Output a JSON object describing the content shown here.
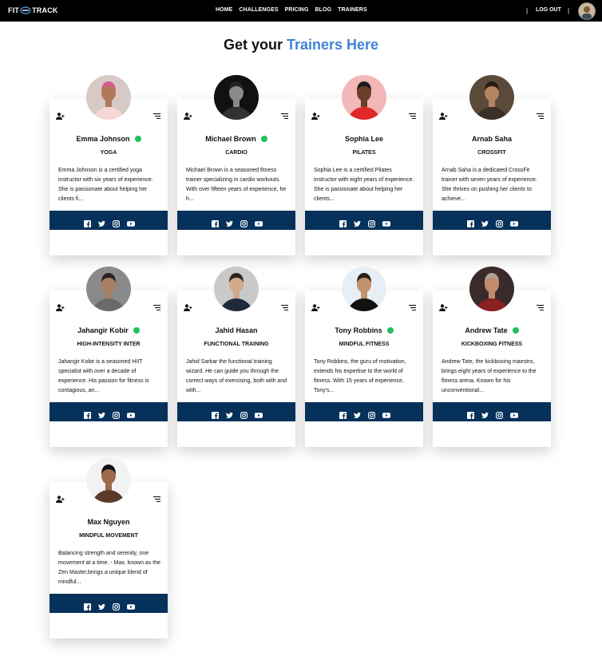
{
  "brand": {
    "left": "FIT",
    "right": "TRACK"
  },
  "nav": [
    "HOME",
    "CHALLENGES",
    "PRICING",
    "BLOG",
    "TRAINERS"
  ],
  "separators": [
    "|",
    "|"
  ],
  "logout": "LOG OUT",
  "heading": {
    "prefix": "Get your ",
    "accent": "Trainers Here"
  },
  "colors": {
    "accent": "#3f83d6",
    "social_bar": "#05315a",
    "online": "#20c05c",
    "topbar": "#000000"
  },
  "trainers": [
    {
      "name": "Emma Johnson",
      "online": true,
      "specialty": "YOGA",
      "bio": "Emma Johnson is a certified yoga instructor with six years of experience. She is passionate about helping her clients fi..."
    },
    {
      "name": "Michael Brown",
      "online": true,
      "specialty": "CARDIO",
      "bio": "Michael Brown is a seasoned fitness trainer specializing in cardio workouts. With over fifteen years of experience, he h..."
    },
    {
      "name": "Sophia Lee",
      "online": false,
      "specialty": "PILATES",
      "bio": "Sophia Lee is a certified Pilates instructor with eight years of experience. She is passionate about helping her clients..."
    },
    {
      "name": "Arnab Saha",
      "online": false,
      "specialty": "CROSSFIT",
      "bio": "Arnab Saha is a dedicated CrossFit trainer with seven years of experience. She thrives on pushing her clients to achieve..."
    },
    {
      "name": "Jahangir Kobir",
      "online": true,
      "specialty": "HIGH-INTENSITY INTER",
      "bio": "Jahangir Kobir is a seasoned HIIT specialist with over a decade of experience. His passion for fitness is contagious, an..."
    },
    {
      "name": "Jahid Hasan",
      "online": false,
      "specialty": "FUNCTIONAL TRAINING",
      "bio": "Jahid Sarkar the functional training wizard. He can guide you through the correct ways of exercising, both with and with..."
    },
    {
      "name": "Tony Robbins",
      "online": true,
      "specialty": "MINDFUL FITNESS",
      "bio": "Tony Robbins, the guru of motivation, extends his expertise to the world of fitness. With 15 years of experience, Tony's..."
    },
    {
      "name": "Andrew Tate",
      "online": true,
      "specialty": "KICKBOXING FITNESS",
      "bio": "Andrew Tate, the kickboxing maestro, brings eight years of experience to the fitness arena. Known for his unconventional..."
    },
    {
      "name": "Max Nguyen",
      "online": false,
      "specialty": "MINDFUL MOVEMENT",
      "bio": "Balancing strength and serenity, one movement at a time. - Max, known as the Zen Master,brings a unique blend of mindful..."
    }
  ],
  "social_icons": [
    "facebook-icon",
    "twitter-icon",
    "instagram-icon",
    "youtube-icon"
  ],
  "card_icons": {
    "left": "add-user-icon",
    "right": "menu-icon"
  }
}
